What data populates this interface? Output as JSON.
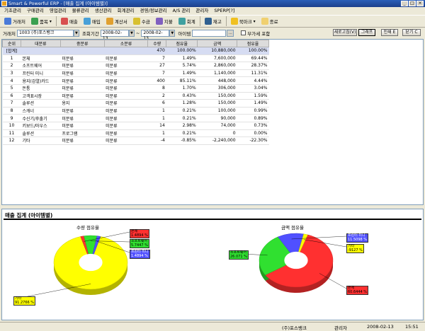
{
  "window": {
    "title": "Smart & Powerful ERP - [매출 집계 (아이템별)]"
  },
  "menu": [
    "기초관리",
    "구매관리",
    "영업관리",
    "물류관리",
    "생산관리",
    "회계관리",
    "경영/정보관리",
    "A/S 관리",
    "관리자",
    "SPERP[?]"
  ],
  "toolbar": [
    {
      "label": "거래처",
      "icon": "people-icon",
      "color": "#4a7ad8",
      "drop": false
    },
    {
      "label": "품목",
      "icon": "box-icon",
      "color": "#3aa050",
      "drop": true
    },
    {
      "label": "매출",
      "icon": "sales-icon",
      "color": "#d85050",
      "drop": false
    },
    {
      "label": "매입",
      "icon": "purchase-icon",
      "color": "#48a0d8",
      "drop": false
    },
    {
      "label": "계산서",
      "icon": "invoice-icon",
      "color": "#e0a030",
      "drop": false
    },
    {
      "label": "수금",
      "icon": "receipt-icon",
      "color": "#d8c030",
      "drop": false
    },
    {
      "label": "지불",
      "icon": "payment-icon",
      "color": "#8060c0",
      "drop": false
    },
    {
      "label": "회계",
      "icon": "ledger-icon",
      "color": "#40a0a0",
      "drop": false
    },
    {
      "label": "재고",
      "icon": "stock-icon",
      "color": "#306090",
      "drop": false
    },
    {
      "label": "북마크",
      "icon": "star-icon",
      "color": "#f0c020",
      "drop": true
    },
    {
      "label": "종료",
      "icon": "exit-icon",
      "color": "#f0d070",
      "drop": false
    }
  ],
  "filter": {
    "branch_label": "거래처",
    "branch_value": "1003 (주)포스뱅크",
    "period_label": "조회기간",
    "date_from": "2008-02-13",
    "date_to": "2008-02-13",
    "item_label": "아이템",
    "item_value": "",
    "lookup_btn": "...",
    "include_label": "부가세 포함",
    "refresh_btn": "새로고침(V)",
    "graph_btn": "그래프",
    "print_btn": "인쇄 E",
    "close_btn": "닫기 C"
  },
  "table": {
    "headers": [
      "순위",
      "대분류",
      "중분류",
      "소분류",
      "수량",
      "점유율",
      "금액",
      "점유율"
    ],
    "total": [
      "[합계]",
      "",
      "",
      "",
      "470",
      "100.00%",
      "10,880,000",
      "100.00%"
    ],
    "rows": [
      [
        "1",
        "본체",
        "미분류",
        "미분류",
        "7",
        "1.49%",
        "7,600,000",
        "69.44%"
      ],
      [
        "2",
        "소프트웨어",
        "미분류",
        "미분류",
        "27",
        "5.74%",
        "2,860,000",
        "28.37%"
      ],
      [
        "3",
        "프린터 미니",
        "미분류",
        "미분류",
        "7",
        "1.49%",
        "1,140,000",
        "11.31%"
      ],
      [
        "4",
        "용지(감열)카드",
        "미분류",
        "미분류",
        "400",
        "85.11%",
        "448,000",
        "4.44%"
      ],
      [
        "5",
        "돈통",
        "미분류",
        "미분류",
        "8",
        "1.70%",
        "306,000",
        "3.04%"
      ],
      [
        "6",
        "고객표시장",
        "미분류",
        "미분류",
        "2",
        "0.43%",
        "150,000",
        "1.59%"
      ],
      [
        "7",
        "솔루션",
        "용지",
        "미분류",
        "6",
        "1.28%",
        "150,000",
        "1.49%"
      ],
      [
        "8",
        "스캐너",
        "미분류",
        "미분류",
        "1",
        "0.21%",
        "100,000",
        "0.99%"
      ],
      [
        "9",
        "수신기/후출기",
        "미분류",
        "미분류",
        "1",
        "0.21%",
        "90,000",
        "0.89%"
      ],
      [
        "10",
        "키보드/마우스",
        "미분류",
        "미분류",
        "14",
        "2.98%",
        "74,000",
        "0.73%"
      ],
      [
        "11",
        "솔루션",
        "프로그램",
        "미분류",
        "1",
        "0.21%",
        "0",
        "0.00%"
      ],
      [
        "12",
        "기타",
        "미분류",
        "미분류",
        "-4",
        "-0.85%",
        "-2,240,000",
        "-22.30%"
      ]
    ]
  },
  "chart_panel": {
    "title": "매출 집계 (아이템별)"
  },
  "chart_data": [
    {
      "type": "pie",
      "title": "수량 점유율",
      "slices": [
        {
          "label": "기타",
          "value_label": "91.2766 %",
          "value": 91.2766,
          "color": "#ffff00"
        },
        {
          "label": "본체",
          "value_label": "1.4894 %",
          "value": 1.4894,
          "color": "#ff3030"
        },
        {
          "label": "소프트웨어",
          "value_label": "5.7447 %",
          "value": 5.7447,
          "color": "#30e030"
        },
        {
          "label": "프린터 미니",
          "value_label": "1.4894 %",
          "value": 1.4894,
          "color": "#5050ff"
        }
      ]
    },
    {
      "type": "pie",
      "title": "금액 점유율",
      "slices": [
        {
          "label": "본체",
          "value_label": "60.6444 %",
          "value": 60.6444,
          "color": "#ff3030"
        },
        {
          "label": "소프트웨어",
          "value_label": "26.071 %",
          "value": 26.071,
          "color": "#30e030"
        },
        {
          "label": "프린터 미니",
          "value_label": "11.5098 %",
          "value": 11.5098,
          "color": "#5050ff"
        },
        {
          "label": "기타",
          "value_label": "-9127 %",
          "value": 1.7748,
          "color": "#ffff00"
        }
      ]
    }
  ],
  "status": {
    "company": "(주)포스뱅크",
    "user": "관리자",
    "date": "2008-02-13",
    "time": "15:51"
  }
}
